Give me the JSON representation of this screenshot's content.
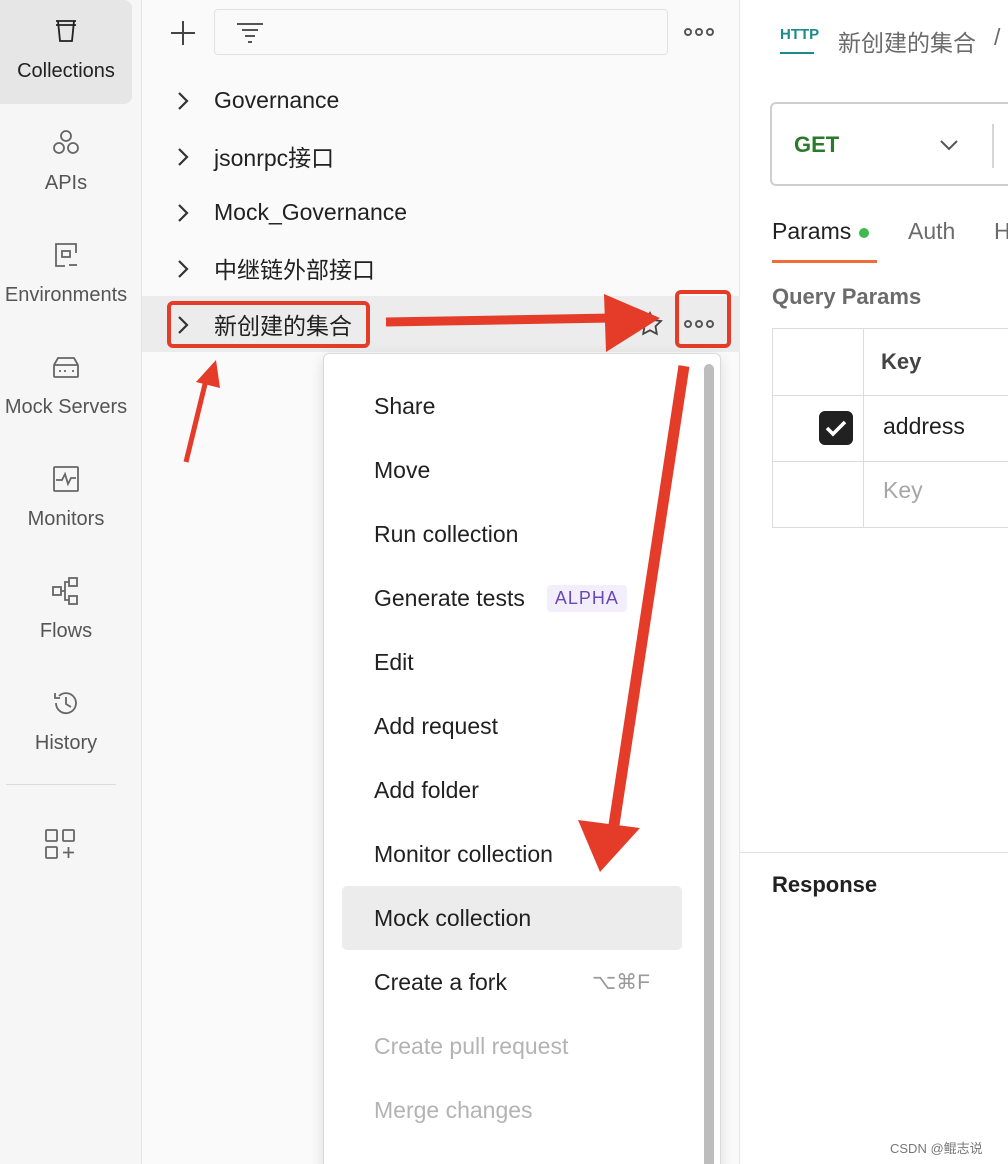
{
  "sidebar": {
    "items": [
      {
        "label": "Collections",
        "icon": "collections-icon",
        "active": true
      },
      {
        "label": "APIs",
        "icon": "apis-icon"
      },
      {
        "label": "Environments",
        "icon": "environments-icon"
      },
      {
        "label": "Mock Servers",
        "icon": "mock-servers-icon"
      },
      {
        "label": "Monitors",
        "icon": "monitors-icon"
      },
      {
        "label": "Flows",
        "icon": "flows-icon"
      },
      {
        "label": "History",
        "icon": "history-icon"
      }
    ],
    "bottom_icon": "add-widget-icon"
  },
  "collections_panel": {
    "tree": [
      {
        "label": "Governance"
      },
      {
        "label": "jsonrpc接口"
      },
      {
        "label": "Mock_Governance"
      },
      {
        "label": "中继链外部接口"
      },
      {
        "label": "新创建的集合",
        "selected": true
      }
    ]
  },
  "context_menu": {
    "items": [
      {
        "label": "Share"
      },
      {
        "label": "Move"
      },
      {
        "label": "Run collection"
      },
      {
        "label": "Generate tests",
        "badge": "ALPHA"
      },
      {
        "label": "Edit"
      },
      {
        "label": "Add request"
      },
      {
        "label": "Add folder"
      },
      {
        "label": "Monitor collection"
      },
      {
        "label": "Mock collection",
        "hovered": true
      },
      {
        "label": "Create a fork",
        "shortcut": "⌥⌘F"
      },
      {
        "label": "Create pull request",
        "disabled": true
      },
      {
        "label": "Merge changes",
        "disabled": true
      }
    ]
  },
  "request": {
    "protocol_icon_text": "HTTP",
    "breadcrumb": "新创建的集合",
    "breadcrumb_sep": "/",
    "method": "GET",
    "tabs": {
      "params": "Params",
      "auth": "Auth",
      "headers_partial": "H"
    },
    "query_params": {
      "title": "Query Params",
      "key_header": "Key",
      "rows": [
        {
          "checked": true,
          "key": "address"
        }
      ],
      "key_placeholder": "Key"
    },
    "response_title": "Response"
  },
  "colors": {
    "annotation_red": "#e53c2a",
    "method_green": "#2b7a2b",
    "tab_accent": "#ef6c3b",
    "params_dot": "#3fb950",
    "alpha_badge": "#6b48b8"
  },
  "watermark": "CSDN @鲲志说"
}
